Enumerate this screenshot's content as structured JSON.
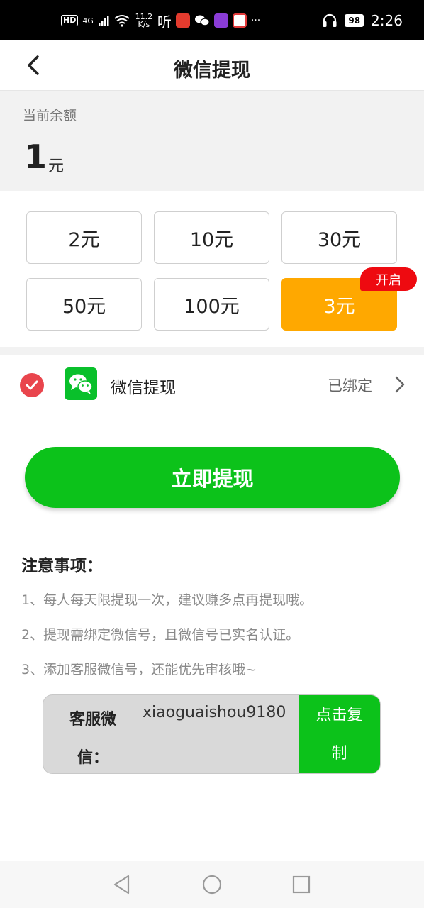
{
  "status_bar": {
    "hd": "HD",
    "signal": "4G",
    "speed_value": "11.2",
    "speed_unit": "K/s",
    "ting": "听",
    "more": "···",
    "battery": "98",
    "time": "2:26"
  },
  "navbar": {
    "title": "微信提现"
  },
  "balance": {
    "label": "当前余额",
    "value": "1",
    "unit": "元"
  },
  "amounts": {
    "items": [
      "2元",
      "10元",
      "30元",
      "50元",
      "100元",
      "3元"
    ],
    "selected": "3元",
    "badge": "开启"
  },
  "method": {
    "label": "微信提现",
    "status": "已绑定"
  },
  "withdraw_button": "立即提现",
  "notes": {
    "title": "注意事项：",
    "items": [
      "1、每人每天限提现一次，建议赚多点再提现哦。",
      "2、提现需绑定微信号，且微信号已实名认证。",
      "3、添加客服微信号，还能优先审核哦~"
    ]
  },
  "contact": {
    "label": "客服微信：",
    "value": "xiaoguaishou9180",
    "copy_label": "点击复制"
  },
  "colors": {
    "accent_green": "#0cc21a",
    "selected_orange": "#ffa800",
    "badge_red": "#ee0a10",
    "check_red": "#e9454d"
  }
}
